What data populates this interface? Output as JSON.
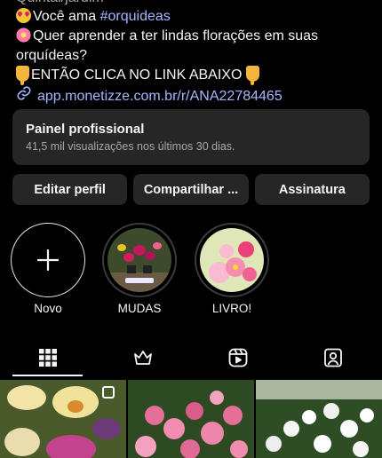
{
  "profile": {
    "category": "Quintal/jardim",
    "bio": {
      "line1_text": "Você ama ",
      "line1_hashtag": "#orquideas",
      "line2": "Quer aprender a ter lindas florações em suas",
      "line3": "orquídeas?",
      "line4": "ENTÃO CLICA NO LINK ABAIXO",
      "link": "app.monetizze.com.br/r/ANA22784465"
    }
  },
  "panel": {
    "title": "Painel profissional",
    "subtitle": "41,5 mil visualizações nos últimos 30 dias."
  },
  "buttons": {
    "edit": "Editar perfil",
    "share": "Compartilhar ...",
    "subscribe": "Assinatura"
  },
  "highlights": [
    {
      "label": "Novo"
    },
    {
      "label": "MUDAS"
    },
    {
      "label": "LIVRO!"
    }
  ],
  "tabs": {
    "icons": [
      "grid-icon",
      "crown-icon",
      "reels-icon",
      "tagged-icon"
    ],
    "active": "grid-icon"
  },
  "colors": {
    "background": "#000000",
    "surface": "#262626",
    "link": "#a6b7ff",
    "secondary_text": "#a8a8a8"
  }
}
